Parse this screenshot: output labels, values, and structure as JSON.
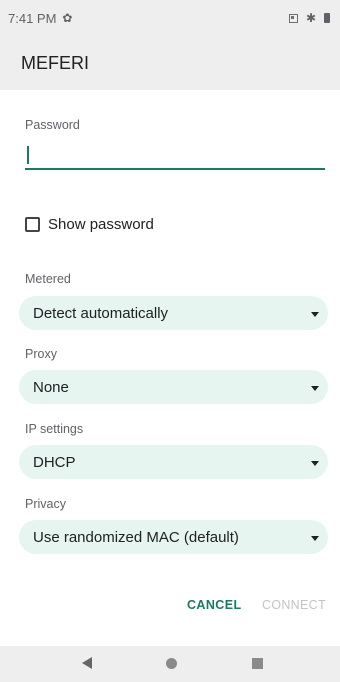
{
  "status_bar": {
    "time": "7:41 PM",
    "icons": [
      "gear-icon",
      "sim-icon",
      "bluetooth-icon",
      "battery-icon"
    ]
  },
  "dialog": {
    "title": "MEFERI",
    "password": {
      "label": "Password",
      "value": ""
    },
    "show_password": {
      "label": "Show password",
      "checked": false
    },
    "metered": {
      "label": "Metered",
      "value": "Detect automatically"
    },
    "proxy": {
      "label": "Proxy",
      "value": "None"
    },
    "ip_settings": {
      "label": "IP settings",
      "value": "DHCP"
    },
    "privacy": {
      "label": "Privacy",
      "value": "Use randomized MAC (default)"
    },
    "actions": {
      "cancel": "CANCEL",
      "connect": "CONNECT"
    }
  },
  "nav_bar": {
    "buttons": [
      "back-icon",
      "home-icon",
      "recents-icon"
    ]
  },
  "colors": {
    "accent": "#1a7a60",
    "dropdown_bg": "#e6f5f0",
    "bar_bg": "#eeeeee"
  }
}
